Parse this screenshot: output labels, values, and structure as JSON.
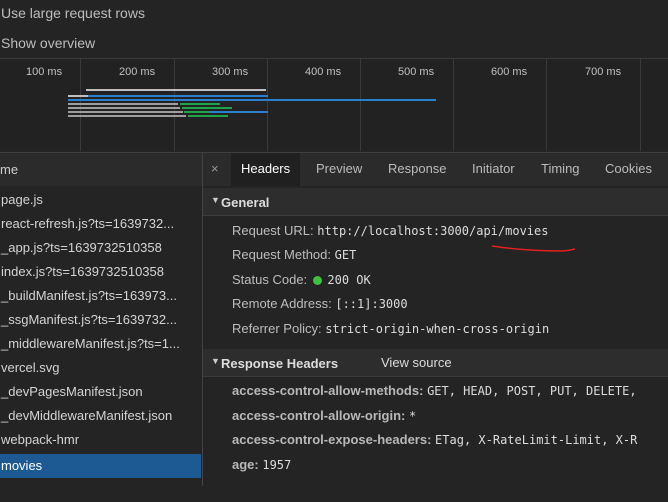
{
  "options": {
    "large_rows": "Use large request rows",
    "show_overview": "Show overview"
  },
  "overview": {
    "ticks": [
      "100 ms",
      "200 ms",
      "300 ms",
      "400 ms",
      "500 ms",
      "600 ms",
      "700 ms"
    ]
  },
  "sidebar": {
    "header": "me",
    "items": [
      {
        "label": "page.js"
      },
      {
        "label": "react-refresh.js?ts=1639732..."
      },
      {
        "label": "_app.js?ts=1639732510358"
      },
      {
        "label": "index.js?ts=1639732510358"
      },
      {
        "label": "_buildManifest.js?ts=163973..."
      },
      {
        "label": "_ssgManifest.js?ts=1639732..."
      },
      {
        "label": "_middlewareManifest.js?ts=1..."
      },
      {
        "label": "vercel.svg"
      },
      {
        "label": "_devPagesManifest.json"
      },
      {
        "label": "_devMiddlewareManifest.json"
      },
      {
        "label": "webpack-hmr"
      },
      {
        "label": "movies"
      },
      {
        "label": ""
      }
    ]
  },
  "tabs": {
    "close": "×",
    "items": [
      "Headers",
      "Preview",
      "Response",
      "Initiator",
      "Timing",
      "Cookies"
    ]
  },
  "general": {
    "title": "General",
    "request_url_label": "Request URL:",
    "request_url_value": "http://localhost:3000/api/movies",
    "request_method_label": "Request Method:",
    "request_method_value": "GET",
    "status_code_label": "Status Code:",
    "status_code_value": "200 OK",
    "remote_address_label": "Remote Address:",
    "remote_address_value": "[::1]:3000",
    "referrer_policy_label": "Referrer Policy:",
    "referrer_policy_value": "strict-origin-when-cross-origin"
  },
  "response_headers": {
    "title": "Response Headers",
    "view_source": "View source",
    "items": [
      {
        "name": "access-control-allow-methods:",
        "value": "GET, HEAD, POST, PUT, DELETE,"
      },
      {
        "name": "access-control-allow-origin:",
        "value": "*"
      },
      {
        "name": "access-control-expose-headers:",
        "value": "ETag, X-RateLimit-Limit, X-R"
      },
      {
        "name": "age:",
        "value": "1957"
      }
    ]
  },
  "colors": {
    "selected_row": "#1d5a93",
    "status_ok": "#3fc13f",
    "annotation": "#e02020"
  }
}
